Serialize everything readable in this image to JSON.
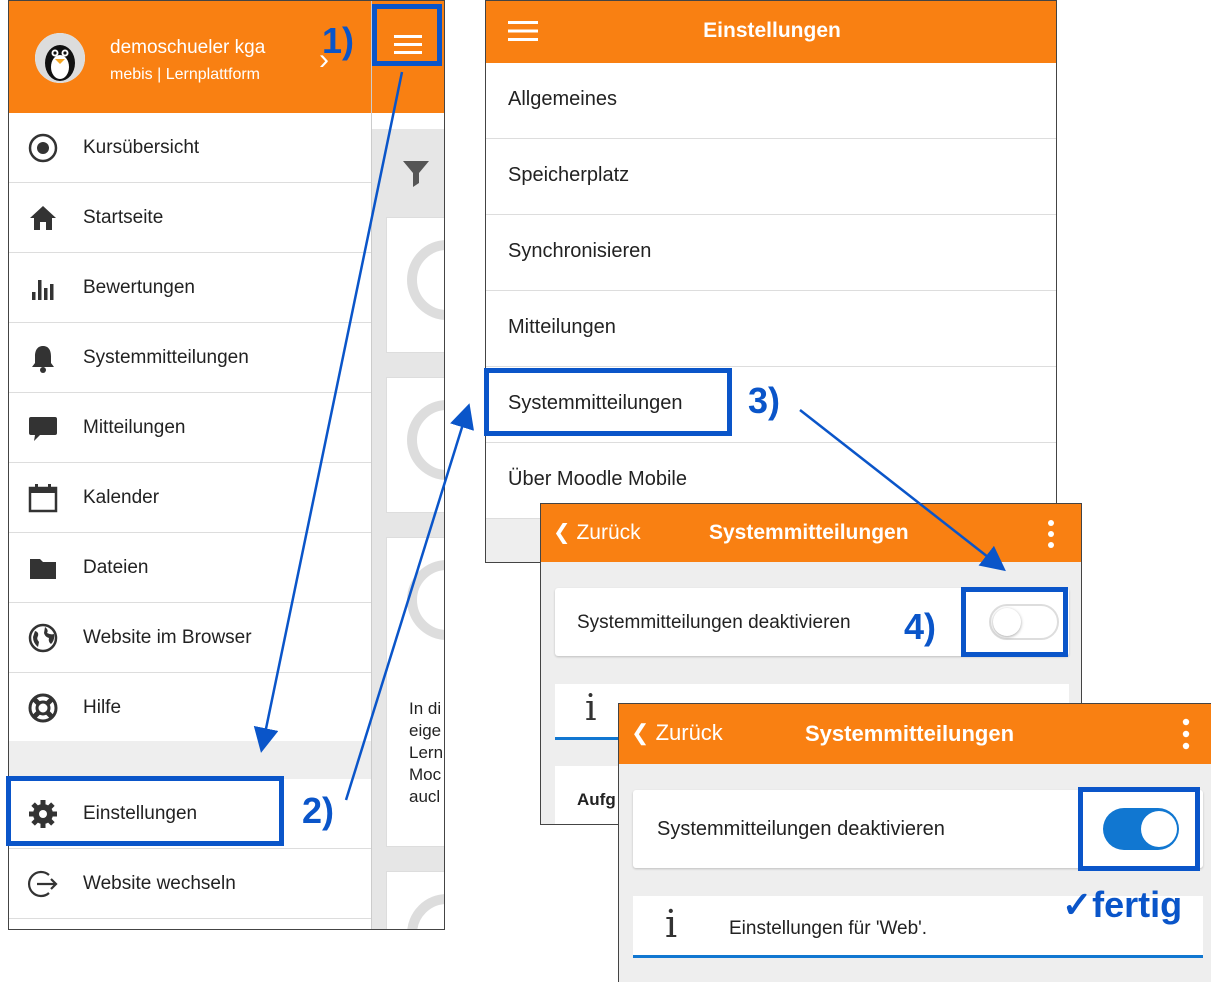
{
  "menu_panel": {
    "user_name": "demoschueler kga",
    "site_name": "mebis | Lernplattform",
    "items": [
      {
        "label": "Kursübersicht",
        "icon": "course-overview-icon"
      },
      {
        "label": "Startseite",
        "icon": "home-icon"
      },
      {
        "label": "Bewertungen",
        "icon": "grades-icon"
      },
      {
        "label": "Systemmitteilungen",
        "icon": "bell-icon"
      },
      {
        "label": "Mitteilungen",
        "icon": "chat-bubble-icon"
      },
      {
        "label": "Kalender",
        "icon": "calendar-icon"
      },
      {
        "label": "Dateien",
        "icon": "folder-icon"
      },
      {
        "label": "Website im Browser",
        "icon": "globe-icon"
      },
      {
        "label": "Hilfe",
        "icon": "lifebuoy-icon"
      },
      {
        "label": "Einstellungen",
        "icon": "gear-icon"
      },
      {
        "label": "Website wechseln",
        "icon": "switch-site-icon"
      }
    ],
    "background_text_lines": [
      "In di",
      "eige",
      "Lern",
      "Moc",
      "aucl"
    ]
  },
  "settings_panel": {
    "title": "Einstellungen",
    "items": [
      "Allgemeines",
      "Speicherplatz",
      "Synchronisieren",
      "Mitteilungen",
      "Systemmitteilungen",
      "Über Moodle Mobile"
    ]
  },
  "notifications_panel_off": {
    "back_label": "Zurück",
    "title": "Systemmitteilungen",
    "toggle_label": "Systemmitteilungen deaktivieren",
    "toggle_state": false,
    "partial_label": "Aufg"
  },
  "notifications_panel_on": {
    "back_label": "Zurück",
    "title": "Systemmitteilungen",
    "toggle_label": "Systemmitteilungen deaktivieren",
    "toggle_state": true,
    "info_text": "Einstellungen für 'Web'."
  },
  "annotations": {
    "step1": "1)",
    "step2": "2)",
    "step3": "3)",
    "step4": "4)",
    "done": "✓fertig"
  },
  "colors": {
    "brand_orange": "#f98012",
    "highlight_blue": "#0a55c9",
    "toggle_blue": "#1177d1"
  }
}
